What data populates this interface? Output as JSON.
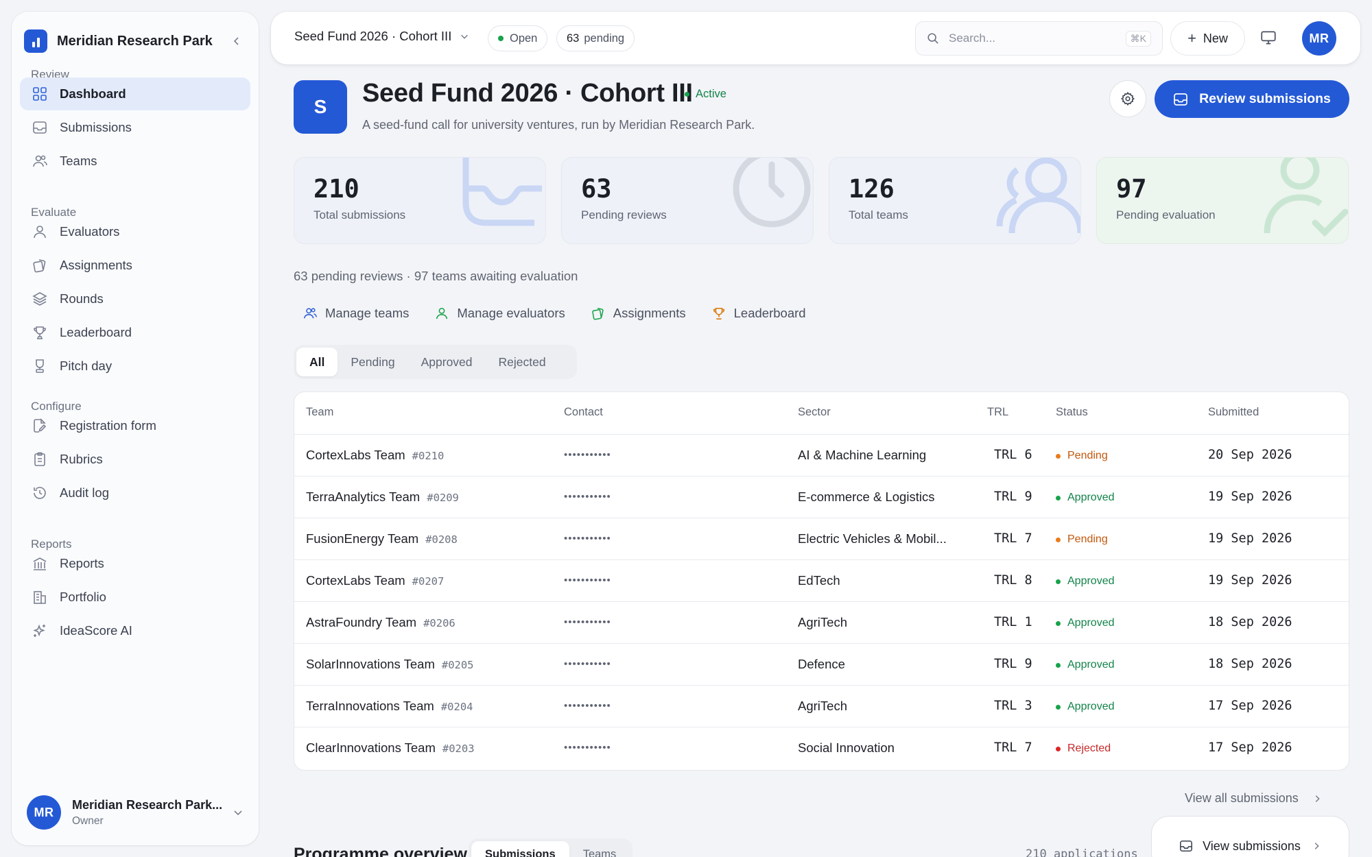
{
  "sidebar": {
    "org_name": "Meridian Research Park",
    "sections": [
      {
        "label": "Review",
        "items": [
          {
            "label": "Dashboard",
            "icon": "grid-icon",
            "active": true
          },
          {
            "label": "Submissions",
            "icon": "inbox-icon"
          },
          {
            "label": "Teams",
            "icon": "users-icon"
          }
        ]
      },
      {
        "label": "Evaluate",
        "items": [
          {
            "label": "Evaluators",
            "icon": "user-icon"
          },
          {
            "label": "Assignments",
            "icon": "cards-icon"
          },
          {
            "label": "Rounds",
            "icon": "layers-icon"
          },
          {
            "label": "Leaderboard",
            "icon": "trophy-icon"
          },
          {
            "label": "Pitch day",
            "icon": "presentation-icon"
          }
        ]
      },
      {
        "label": "Configure",
        "items": [
          {
            "label": "Registration form",
            "icon": "form-edit-icon"
          },
          {
            "label": "Rubrics",
            "icon": "clipboard-icon"
          },
          {
            "label": "Audit log",
            "icon": "history-icon"
          }
        ]
      },
      {
        "label": "Reports",
        "items": [
          {
            "label": "Reports",
            "icon": "bank-icon"
          },
          {
            "label": "Portfolio",
            "icon": "building-icon"
          },
          {
            "label": "IdeaScore AI",
            "icon": "sparkles-icon"
          }
        ]
      }
    ],
    "user": {
      "initials": "MR",
      "name": "Meridian Research Park...",
      "role": "Owner"
    }
  },
  "topbar": {
    "cohort": "Seed Fund 2026 · Cohort III",
    "status_pill": "Open",
    "pending_count": "63",
    "pending_label": "pending",
    "search_placeholder": "Search...",
    "search_shortcut": "⌘K",
    "new_label": "New",
    "user_initials": "MR"
  },
  "header": {
    "badge_letter": "S",
    "title": "Seed Fund 2026 · Cohort III",
    "status": "Active",
    "subtitle": "A seed-fund call for university ventures, run by Meridian Research Park.",
    "review_button": "Review submissions"
  },
  "stats": [
    {
      "value": "210",
      "label": "Total submissions",
      "icon": "inbox-icon"
    },
    {
      "value": "63",
      "label": "Pending reviews",
      "icon": "clock-icon"
    },
    {
      "value": "126",
      "label": "Total teams",
      "icon": "users-icon"
    },
    {
      "value": "97",
      "label": "Pending evaluation",
      "icon": "user-check-icon"
    }
  ],
  "summary": "63 pending reviews · 97 teams awaiting evaluation",
  "quick_links": [
    {
      "label": "Manage teams",
      "icon": "users-icon",
      "color": "#2f62d8"
    },
    {
      "label": "Manage evaluators",
      "icon": "user-icon",
      "color": "#17a34a"
    },
    {
      "label": "Assignments",
      "icon": "cards-icon",
      "color": "#17a34a"
    },
    {
      "label": "Leaderboard",
      "icon": "trophy-icon",
      "color": "#d97706"
    }
  ],
  "filter_tabs": [
    "All",
    "Pending",
    "Approved",
    "Rejected"
  ],
  "table": {
    "columns": [
      "Team",
      "Contact",
      "Sector",
      "TRL",
      "Status",
      "Submitted"
    ],
    "rows": [
      {
        "team": "CortexLabs Team",
        "id": "#0210",
        "contact": "•••••••••••",
        "sector": "AI & Machine Learning",
        "trl": "TRL 6",
        "status": "Pending",
        "date": "20 Sep 2026"
      },
      {
        "team": "TerraAnalytics Team",
        "id": "#0209",
        "contact": "•••••••••••",
        "sector": "E-commerce & Logistics",
        "trl": "TRL 9",
        "status": "Approved",
        "date": "19 Sep 2026"
      },
      {
        "team": "FusionEnergy Team",
        "id": "#0208",
        "contact": "•••••••••••",
        "sector": "Electric Vehicles & Mobil...",
        "trl": "TRL 7",
        "status": "Pending",
        "date": "19 Sep 2026"
      },
      {
        "team": "CortexLabs Team",
        "id": "#0207",
        "contact": "•••••••••••",
        "sector": "EdTech",
        "trl": "TRL 8",
        "status": "Approved",
        "date": "19 Sep 2026"
      },
      {
        "team": "AstraFoundry Team",
        "id": "#0206",
        "contact": "•••••••••••",
        "sector": "AgriTech",
        "trl": "TRL 1",
        "status": "Approved",
        "date": "18 Sep 2026"
      },
      {
        "team": "SolarInnovations Team",
        "id": "#0205",
        "contact": "•••••••••••",
        "sector": "Defence",
        "trl": "TRL 9",
        "status": "Approved",
        "date": "18 Sep 2026"
      },
      {
        "team": "TerraInnovations Team",
        "id": "#0204",
        "contact": "•••••••••••",
        "sector": "AgriTech",
        "trl": "TRL 3",
        "status": "Approved",
        "date": "17 Sep 2026"
      },
      {
        "team": "ClearInnovations Team",
        "id": "#0203",
        "contact": "•••••••••••",
        "sector": "Social Innovation",
        "trl": "TRL 7",
        "status": "Rejected",
        "date": "17 Sep 2026"
      }
    ]
  },
  "view_all": "View all submissions",
  "overview": {
    "title": "Programme overview",
    "tabs": [
      "Submissions",
      "Teams"
    ],
    "count": "210 applications",
    "button": "View submissions"
  },
  "colors": {
    "accent": "#2459d6",
    "pending": "#c2570c",
    "approved": "#12834a",
    "rejected": "#c42a2a",
    "active": "#17a34a"
  }
}
